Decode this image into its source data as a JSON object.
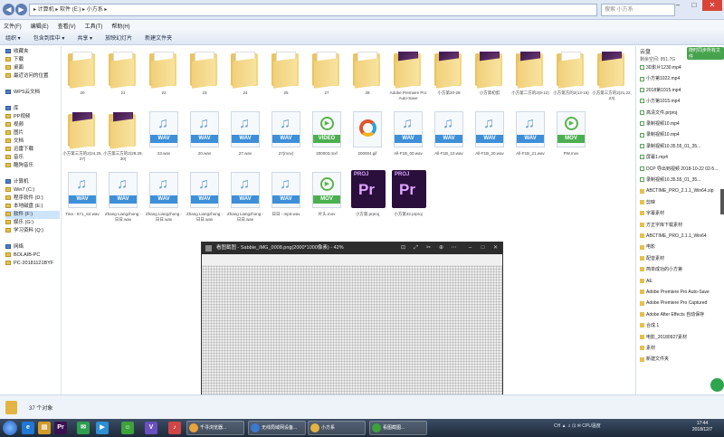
{
  "address": {
    "back_glyph": "◀",
    "forward_glyph": "▶",
    "path": "▸ 计算机 ▸ 软件 (E:) ▸ 小方系 ▸",
    "search_placeholder": "搜索 小方系"
  },
  "window_controls": {
    "minimize": "–",
    "maximize": "□",
    "close": "✕"
  },
  "menu": [
    "文件(F)",
    "编辑(E)",
    "查看(V)",
    "工具(T)",
    "帮助(H)"
  ],
  "toolbar": [
    "组织 ▾",
    "包含到库中 ▾",
    "共享 ▾",
    "放映幻灯片",
    "新建文件夹"
  ],
  "nav": [
    {
      "label": "收藏夹",
      "hdr": true
    },
    {
      "label": "下载"
    },
    {
      "label": "桌面"
    },
    {
      "label": "最近访问的位置"
    },
    {
      "label": "WPS云文档",
      "hdr": true
    },
    {
      "label": "库",
      "hdr": true
    },
    {
      "label": "PP视频"
    },
    {
      "label": "视频"
    },
    {
      "label": "图片"
    },
    {
      "label": "文档"
    },
    {
      "label": "迅雷下载"
    },
    {
      "label": "音乐"
    },
    {
      "label": "酷狗音乐"
    },
    {
      "label": "计算机",
      "hdr": true
    },
    {
      "label": "Win7 (C:)"
    },
    {
      "label": "程序软件 (D:)"
    },
    {
      "label": "本地磁盘 (E:)"
    },
    {
      "label": "软件 (F:)",
      "sel": true
    },
    {
      "label": "娱乐 (G:)"
    },
    {
      "label": "学习资料 (Q:)"
    },
    {
      "label": "网络",
      "hdr": true
    },
    {
      "label": "BOLAIB-PC"
    },
    {
      "label": "PC-20181121BYF"
    }
  ],
  "files": [
    {
      "type": "folder",
      "label": "20"
    },
    {
      "type": "folder",
      "label": "21"
    },
    {
      "type": "folder",
      "label": "22"
    },
    {
      "type": "folder",
      "label": "23"
    },
    {
      "type": "folder",
      "label": "24"
    },
    {
      "type": "folder",
      "label": "25"
    },
    {
      "type": "folder",
      "label": "27"
    },
    {
      "type": "folder",
      "label": "28"
    },
    {
      "type": "folder-dark",
      "label": "Adobe Premiere Pro Auto-Save"
    },
    {
      "type": "folder-dark",
      "label": "小方第20-28"
    },
    {
      "type": "folder-dark",
      "label": "小方第初剪"
    },
    {
      "type": "folder-dark",
      "label": "小方第二方的2(9-12)"
    },
    {
      "type": "folder",
      "label": "小方第方的2(13-16)"
    },
    {
      "type": "folder-dark",
      "label": "小方第三方的2(21,22,23)"
    },
    {
      "type": "folder-dark",
      "label": "小方第三方的2(24,25,27)"
    },
    {
      "type": "folder-dark",
      "label": "小方第三方的2(28,29,30)"
    },
    {
      "type": "wav",
      "label": "23.wav"
    },
    {
      "type": "wav",
      "label": "20.wav"
    },
    {
      "type": "wav",
      "label": "27.wav"
    },
    {
      "type": "wav",
      "label": "27(mov)"
    },
    {
      "type": "video",
      "label": "200003.mxf"
    },
    {
      "type": "img",
      "label": "200004.gif"
    },
    {
      "type": "wav",
      "label": "All-F1B_00.wav"
    },
    {
      "type": "wav",
      "label": "All-F1B_10.wav"
    },
    {
      "type": "wav",
      "label": "All-F1B_20.wav"
    },
    {
      "type": "wav",
      "label": "All-F1B_21.wav"
    },
    {
      "type": "mov",
      "label": "PW.mov"
    },
    {
      "type": "wav",
      "label": "Tina - 571_S2.wav"
    },
    {
      "type": "wav",
      "label": "Zhang Liangzhong - 日日.wav"
    },
    {
      "type": "wav",
      "label": "Zhang Liangzhong - 日日.wav"
    },
    {
      "type": "wav",
      "label": "Zhang Liangzhong - 日日.wav"
    },
    {
      "type": "wav",
      "label": "Zhang Liangzhong - 日日.wav"
    },
    {
      "type": "wav",
      "label": "日日 - mp3.wav"
    },
    {
      "type": "mov",
      "label": "片头.mov"
    },
    {
      "type": "prproj",
      "label": "小方第.prproj"
    },
    {
      "type": "prproj",
      "label": "小方第32.prproj"
    }
  ],
  "labels": {
    "wav": "WAV",
    "video": "VIDEO",
    "mov": "MOV",
    "note_glyph": "♫",
    "play_glyph": "▶",
    "pr_top": "PROJ",
    "pr_main": "Pr"
  },
  "rpanel": {
    "head": "云盘",
    "tag": "随时同步所有文件",
    "space": "剩余空间: 851.7G",
    "items": [
      {
        "label": "3D影片1230.mp4",
        "kind": "file"
      },
      {
        "label": "小方第1022.mp4",
        "kind": "file"
      },
      {
        "label": "2018第1015.mp4",
        "kind": "file"
      },
      {
        "label": "小方第1015.mp4",
        "kind": "file"
      },
      {
        "label": "高清文件.prproj",
        "kind": "file"
      },
      {
        "label": "录制视频10.mp4",
        "kind": "file"
      },
      {
        "label": "录制视频10.mp4",
        "kind": "file"
      },
      {
        "label": "录制视频10.35.55_01_35...",
        "kind": "file"
      },
      {
        "label": "屏幕1.mp4",
        "kind": "file"
      },
      {
        "label": "DCP 导出到视频 2018-10-22 02-5...",
        "kind": "file"
      },
      {
        "label": "录制视频10.35.55_01_35...",
        "kind": "file"
      },
      {
        "label": "ABCTIME_PRO_2.1.1_Win64.zip",
        "kind": "folder"
      },
      {
        "label": "剪映",
        "kind": "folder"
      },
      {
        "label": "字幕素材",
        "kind": "folder"
      },
      {
        "label": "方正字库下载素材",
        "kind": "folder"
      },
      {
        "label": "ABCTIME_PRO_2.1.1_Win64",
        "kind": "folder"
      },
      {
        "label": "电影",
        "kind": "folder"
      },
      {
        "label": "配音素材",
        "kind": "folder"
      },
      {
        "label": "简单成功的小方第",
        "kind": "folder"
      },
      {
        "label": "AE",
        "kind": "folder"
      },
      {
        "label": "Adobe Premiere Pro Auto-Save",
        "kind": "folder"
      },
      {
        "label": "Adobe Premiere Pro Captured",
        "kind": "folder"
      },
      {
        "label": "Adobe After Effects 自动保存",
        "kind": "folder"
      },
      {
        "label": "合成.1",
        "kind": "folder"
      },
      {
        "label": "电影_20180927素材",
        "kind": "folder"
      },
      {
        "label": "素材",
        "kind": "folder"
      },
      {
        "label": "新建文件夹",
        "kind": "folder"
      }
    ]
  },
  "viewer": {
    "title": "看图截图 - Sabbie_IMG_0008.png(2000*1000像素) - 42%",
    "buttons": [
      "⊡",
      "⤢",
      "✂",
      "⊕",
      "⋯",
      "–",
      "□",
      "✕"
    ]
  },
  "status": {
    "text": "37 个对象"
  },
  "taskbar": {
    "icons": [
      {
        "glyph": "e",
        "color": "#1e78d4"
      },
      {
        "glyph": "▤",
        "color": "#d39b2b"
      },
      {
        "glyph": "Pr",
        "color": "#3a1150"
      },
      {
        "glyph": "✉",
        "color": "#2d9f4f"
      },
      {
        "glyph": "▶",
        "color": "#2d8fd4"
      },
      {
        "glyph": "☺",
        "color": "#3ca33c"
      },
      {
        "glyph": "V",
        "color": "#6a4fbf"
      },
      {
        "glyph": "♪",
        "color": "#d04646"
      }
    ],
    "tasks": [
      {
        "label": "千寻浏览器...",
        "color": "#e8a33c"
      },
      {
        "label": "无线局域网设备...",
        "color": "#3b7ad0"
      },
      {
        "label": "小方系",
        "color": "#e3b443"
      },
      {
        "label": "看图截图...",
        "color": "#3ca33c"
      }
    ],
    "tray": "CH  ▲  ♫  ⊡  ✉  CPU温度",
    "time": "17:44",
    "date": "2018/12/7"
  }
}
